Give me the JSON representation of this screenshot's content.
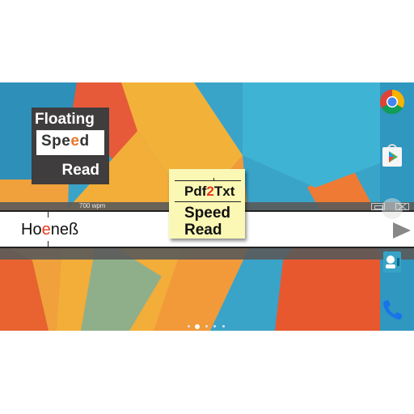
{
  "floating_widget": {
    "title": "Floating",
    "word_before": "Spe",
    "word_orp": "e",
    "word_after": "d",
    "read_label": "Read"
  },
  "reader": {
    "wpm": "700 wpm",
    "word_before": "Ho",
    "word_orp": "e",
    "word_after": "neß"
  },
  "sticky_note": {
    "line1_before": "Pdf",
    "line1_orp": "2",
    "line1_after": "Txt",
    "line2": "Speed",
    "line3": "Read"
  },
  "home_screen": {
    "page_count": 5,
    "active_page": 2
  },
  "icons": {
    "dock": [
      "chrome-icon",
      "play-store-icon",
      "contacts-icon",
      "phone-icon"
    ],
    "reader": [
      "maximize-icon",
      "close-icon",
      "play-icon"
    ]
  },
  "colors": {
    "accent_orange": "#e8772a",
    "accent_red": "#e8391f",
    "sticky_yellow": "#fbf7b4",
    "widget_dark": "#3f3d3d",
    "wallpaper_blue": "#3aa3c8"
  }
}
